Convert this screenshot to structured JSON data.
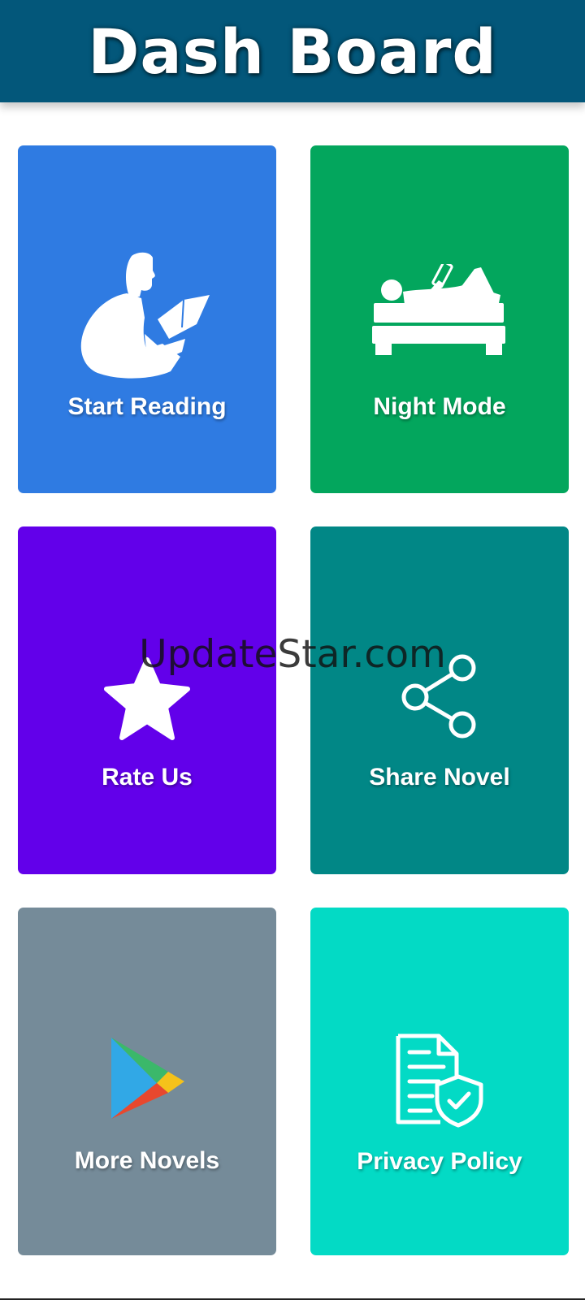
{
  "header": {
    "title": "Dash Board",
    "color": "#03577a"
  },
  "cards": [
    {
      "label": "Start Reading",
      "color": "#2f7be2",
      "icon": "reading-person-icon"
    },
    {
      "label": "Night Mode",
      "color": "#03a65d",
      "icon": "bed-reading-icon"
    },
    {
      "label": "Rate Us",
      "color": "#6200ea",
      "icon": "star-icon"
    },
    {
      "label": "Share Novel",
      "color": "#018786",
      "icon": "share-icon"
    },
    {
      "label": "More Novels",
      "color": "#758b99",
      "icon": "play-store-icon"
    },
    {
      "label": "Privacy Policy",
      "color": "#03dac5",
      "icon": "privacy-document-icon"
    }
  ],
  "watermark": {
    "text": "UpdateStar.com"
  }
}
